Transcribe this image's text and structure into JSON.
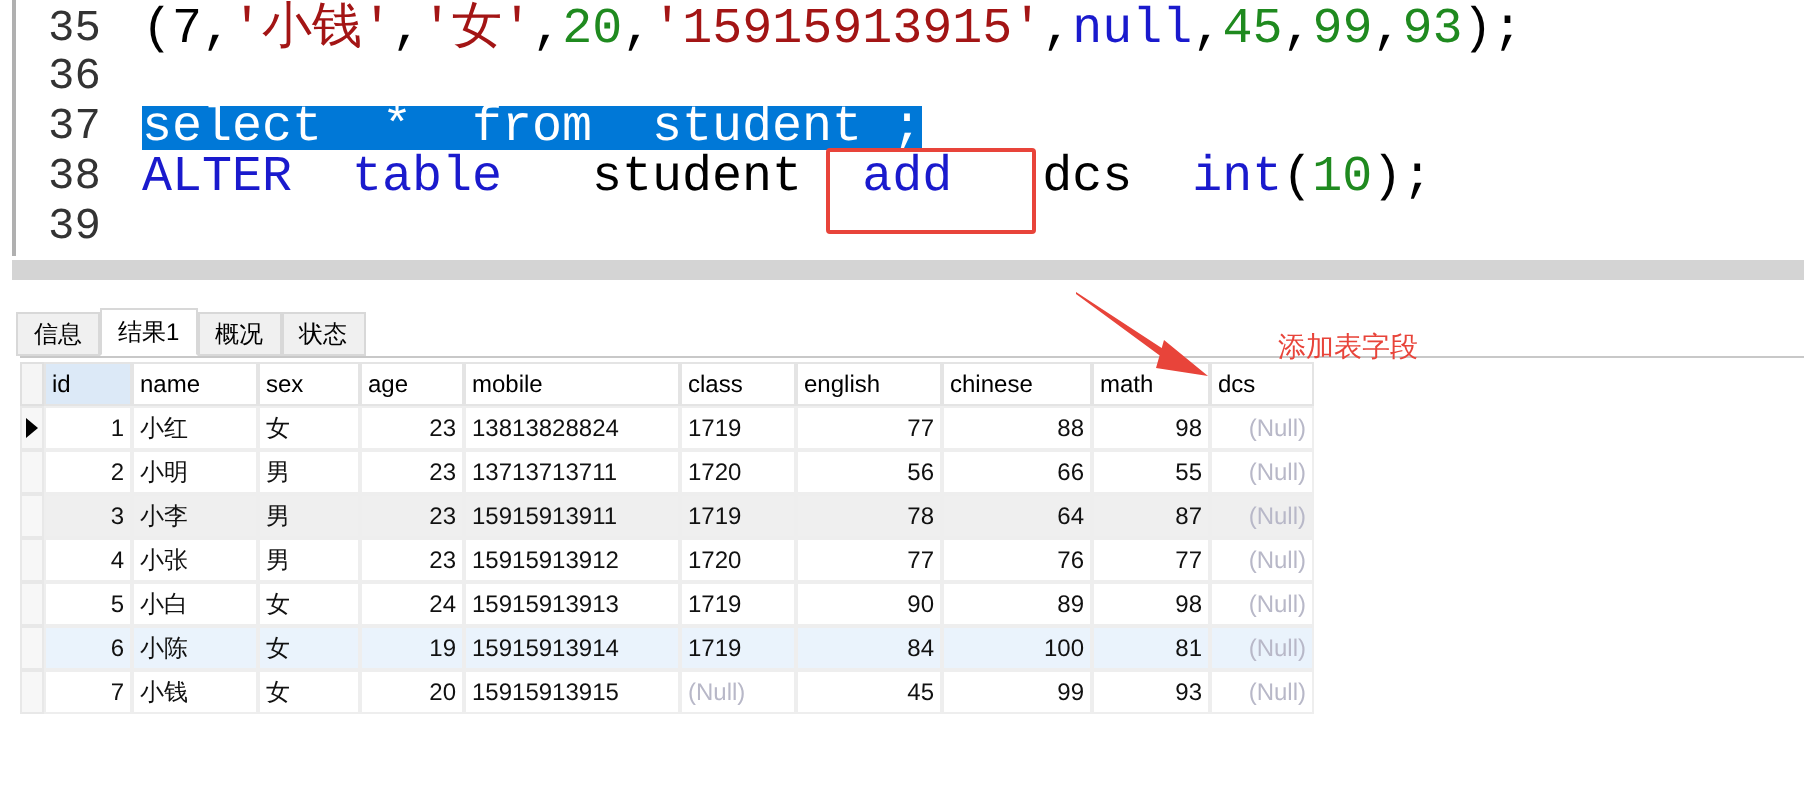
{
  "editor": {
    "lines": [
      {
        "number": "35",
        "selected": false,
        "tokens": [
          {
            "kind": "plain",
            "text": "(7,"
          },
          {
            "kind": "string",
            "text": "'小钱'"
          },
          {
            "kind": "plain",
            "text": ","
          },
          {
            "kind": "string",
            "text": "'女'"
          },
          {
            "kind": "plain",
            "text": ","
          },
          {
            "kind": "number",
            "text": "20"
          },
          {
            "kind": "plain",
            "text": ","
          },
          {
            "kind": "string",
            "text": "'15915913915'"
          },
          {
            "kind": "plain",
            "text": ","
          },
          {
            "kind": "keyword",
            "text": "null"
          },
          {
            "kind": "plain",
            "text": ","
          },
          {
            "kind": "number",
            "text": "45"
          },
          {
            "kind": "plain",
            "text": ","
          },
          {
            "kind": "number",
            "text": "99"
          },
          {
            "kind": "plain",
            "text": ","
          },
          {
            "kind": "number",
            "text": "93"
          },
          {
            "kind": "plain",
            "text": ");"
          }
        ]
      },
      {
        "number": "36"
      },
      {
        "number": "37",
        "selected": true,
        "tokens": [
          {
            "kind": "plain",
            "text": "select  *  from  student ;"
          }
        ]
      },
      {
        "number": "38",
        "selected": false,
        "tokens": [
          {
            "kind": "keyword",
            "text": "ALTER  table"
          },
          {
            "kind": "plain",
            "text": "   student  "
          },
          {
            "kind": "keyword",
            "text": "add"
          },
          {
            "kind": "plain",
            "text": "   dcs  "
          },
          {
            "kind": "keyword",
            "text": "int"
          },
          {
            "kind": "plain",
            "text": "("
          },
          {
            "kind": "number",
            "text": "10"
          },
          {
            "kind": "plain",
            "text": ");"
          }
        ]
      },
      {
        "number": "39"
      }
    ]
  },
  "tabs": [
    {
      "label": "信息",
      "selected": false
    },
    {
      "label": "结果1",
      "selected": true
    },
    {
      "label": "概况",
      "selected": false
    },
    {
      "label": "状态",
      "selected": false
    }
  ],
  "table": {
    "columns": [
      "id",
      "name",
      "sex",
      "age",
      "mobile",
      "class",
      "english",
      "chinese",
      "math",
      "dcs"
    ],
    "rows": [
      {
        "current": true,
        "hovered": false,
        "selected": false,
        "cells": [
          {
            "text": "1",
            "null": false
          },
          {
            "text": "小红",
            "null": false
          },
          {
            "text": "女",
            "null": false
          },
          {
            "text": "23",
            "null": false
          },
          {
            "text": "13813828824",
            "null": false
          },
          {
            "text": "1719",
            "null": false
          },
          {
            "text": "77",
            "null": false
          },
          {
            "text": "88",
            "null": false
          },
          {
            "text": "98",
            "null": false
          },
          {
            "text": "(Null)",
            "null": true
          }
        ]
      },
      {
        "current": false,
        "hovered": false,
        "selected": false,
        "cells": [
          {
            "text": "2",
            "null": false
          },
          {
            "text": "小明",
            "null": false
          },
          {
            "text": "男",
            "null": false
          },
          {
            "text": "23",
            "null": false
          },
          {
            "text": "13713713711",
            "null": false
          },
          {
            "text": "1720",
            "null": false
          },
          {
            "text": "56",
            "null": false
          },
          {
            "text": "66",
            "null": false
          },
          {
            "text": "55",
            "null": false
          },
          {
            "text": "(Null)",
            "null": true
          }
        ]
      },
      {
        "current": false,
        "hovered": true,
        "selected": false,
        "cells": [
          {
            "text": "3",
            "null": false
          },
          {
            "text": "小李",
            "null": false
          },
          {
            "text": "男",
            "null": false
          },
          {
            "text": "23",
            "null": false
          },
          {
            "text": "15915913911",
            "null": false
          },
          {
            "text": "1719",
            "null": false
          },
          {
            "text": "78",
            "null": false
          },
          {
            "text": "64",
            "null": false
          },
          {
            "text": "87",
            "null": false
          },
          {
            "text": "(Null)",
            "null": true
          }
        ]
      },
      {
        "current": false,
        "hovered": false,
        "selected": false,
        "cells": [
          {
            "text": "4",
            "null": false
          },
          {
            "text": "小张",
            "null": false
          },
          {
            "text": "男",
            "null": false
          },
          {
            "text": "23",
            "null": false
          },
          {
            "text": "15915913912",
            "null": false
          },
          {
            "text": "1720",
            "null": false
          },
          {
            "text": "77",
            "null": false
          },
          {
            "text": "76",
            "null": false
          },
          {
            "text": "77",
            "null": false
          },
          {
            "text": "(Null)",
            "null": true
          }
        ]
      },
      {
        "current": false,
        "hovered": false,
        "selected": false,
        "cells": [
          {
            "text": "5",
            "null": false
          },
          {
            "text": "小白",
            "null": false
          },
          {
            "text": "女",
            "null": false
          },
          {
            "text": "24",
            "null": false
          },
          {
            "text": "15915913913",
            "null": false
          },
          {
            "text": "1719",
            "null": false
          },
          {
            "text": "90",
            "null": false
          },
          {
            "text": "89",
            "null": false
          },
          {
            "text": "98",
            "null": false
          },
          {
            "text": "(Null)",
            "null": true
          }
        ]
      },
      {
        "current": false,
        "hovered": false,
        "selected": true,
        "cells": [
          {
            "text": "6",
            "null": false
          },
          {
            "text": "小陈",
            "null": false
          },
          {
            "text": "女",
            "null": false
          },
          {
            "text": "19",
            "null": false
          },
          {
            "text": "15915913914",
            "null": false
          },
          {
            "text": "1719",
            "null": false
          },
          {
            "text": "84",
            "null": false
          },
          {
            "text": "100",
            "null": false
          },
          {
            "text": "81",
            "null": false
          },
          {
            "text": "(Null)",
            "null": true
          }
        ]
      },
      {
        "current": false,
        "hovered": false,
        "selected": false,
        "cells": [
          {
            "text": "7",
            "null": false
          },
          {
            "text": "小钱",
            "null": false
          },
          {
            "text": "女",
            "null": false
          },
          {
            "text": "20",
            "null": false
          },
          {
            "text": "15915913915",
            "null": false
          },
          {
            "text": "(Null)",
            "null": true
          },
          {
            "text": "45",
            "null": false
          },
          {
            "text": "99",
            "null": false
          },
          {
            "text": "93",
            "null": false
          },
          {
            "text": "(Null)",
            "null": true
          }
        ]
      }
    ]
  },
  "annotation": {
    "label": "添加表字段"
  }
}
